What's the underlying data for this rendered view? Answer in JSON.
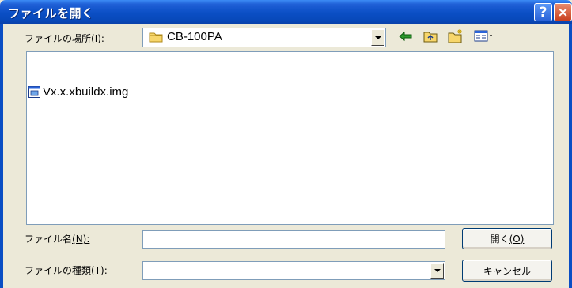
{
  "window": {
    "title": "ファイルを開く",
    "help_label": "?",
    "close_label": "×"
  },
  "location": {
    "label_text": "ファイルの場所",
    "label_key": "(I):",
    "value": "CB-100PA"
  },
  "toolbar": {
    "icons": [
      "back-arrow-icon",
      "up-folder-icon",
      "new-folder-icon",
      "view-menu-icon"
    ]
  },
  "file_list": {
    "items": [
      {
        "name": "Vx.x.xbuildx.img",
        "icon": "image-file-icon"
      }
    ]
  },
  "filename": {
    "label_text": "ファイル名",
    "label_key": "(N):",
    "value": ""
  },
  "filetype": {
    "label_text": "ファイルの種類",
    "label_key": "(T):",
    "value": ""
  },
  "buttons": {
    "open_text": "開く",
    "open_key": "(O)",
    "cancel_label": "キャンセル"
  },
  "colors": {
    "title_bar": "#0a4ec4",
    "dialog_bg": "#ece9d8",
    "field_border": "#7f9db9"
  }
}
